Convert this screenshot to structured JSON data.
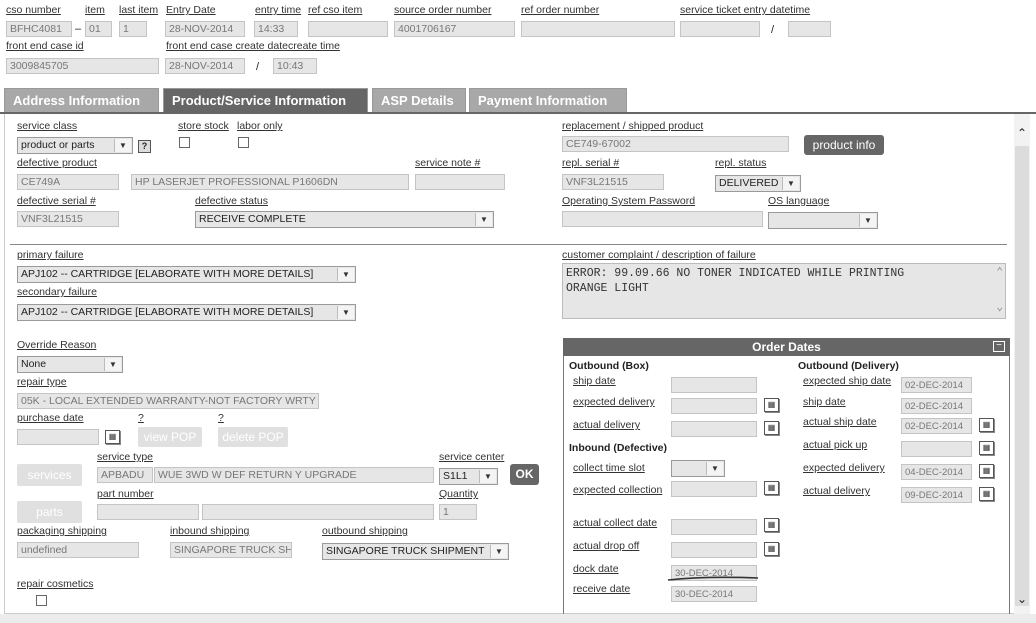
{
  "header": {
    "cso_number_label": "cso number",
    "cso_number": "BFHC4081",
    "dash": "–",
    "item_label": "item",
    "item": "01",
    "last_item_label": "last item",
    "last_item": "1",
    "entry_date_label": "Entry Date",
    "entry_date": "28-NOV-2014",
    "entry_time_label": "entry time",
    "entry_time": "14:33",
    "ref_cso_item_label": "ref cso item",
    "ref_cso_item": "",
    "source_order_label": "source order number",
    "source_order": "4001706167",
    "ref_order_label": "ref order number",
    "ref_order": "",
    "service_ticket_label": "service ticket entry datetime",
    "service_ticket_date": "",
    "slash": "/",
    "service_ticket_time": "",
    "front_end_case_label": "front end case id",
    "front_end_case": "3009845705",
    "front_end_create_label": "front end case create datecreate time",
    "front_end_create_date": "28-NOV-2014",
    "front_end_create_time": "10:43"
  },
  "tabs": [
    "Address Information",
    "Product/Service Information",
    "ASP Details",
    "Payment Information"
  ],
  "product": {
    "service_class_label": "service class",
    "service_class": "product or parts",
    "help_glyph": "?",
    "store_stock_label": "store stock",
    "labor_only_label": "labor only",
    "defective_product_label": "defective product",
    "defective_product": "CE749A",
    "defective_product_desc": "HP LASERJET PROFESSIONAL P1606DN",
    "service_note_label": "service note #",
    "service_note": "",
    "defective_serial_label": "defective serial #",
    "defective_serial": "VNF3L21515",
    "defective_status_label": "defective status",
    "defective_status": "RECEIVE COMPLETE",
    "replacement_label": "replacement / shipped product",
    "replacement": "CE749-67002",
    "product_info_button": "product info",
    "repl_serial_label": "repl. serial #",
    "repl_serial": "VNF3L21515",
    "repl_status_label": "repl. status",
    "repl_status": "DELIVERED",
    "os_password_label": "Operating System Password",
    "os_password": "",
    "os_language_label": "OS language",
    "os_language": ""
  },
  "failure": {
    "primary_label": "primary failure",
    "primary": "APJ102 -- CARTRIDGE [ELABORATE WITH MORE DETAILS]",
    "secondary_label": "secondary failure",
    "secondary": "APJ102 -- CARTRIDGE [ELABORATE WITH MORE DETAILS]",
    "complaint_label": "customer complaint / description of failure",
    "complaint_line1": "ERROR: 99.09.66 NO TONER INDICATED WHILE PRINTING",
    "complaint_line2": "ORANGE LIGHT"
  },
  "repair": {
    "override_label": "Override Reason",
    "override": "None",
    "repair_type_label": "repair type",
    "repair_type": "05K - LOCAL EXTENDED WARRANTY-NOT FACTORY WRTY",
    "purchase_date_label": "purchase date",
    "purchase_date": "",
    "q1": "?",
    "q2": "?",
    "view_pop": "view POP",
    "delete_pop": "delete POP",
    "services_button": "services",
    "service_type_label": "service type",
    "service_type_code": "APBADU",
    "service_type_desc": "WUE 3WD W DEF RETURN Y UPGRADE",
    "service_center_label": "service center",
    "service_center": "S1L1",
    "ok_button": "OK",
    "parts_button": "parts",
    "part_number_label": "part number",
    "part_number": "",
    "part_desc": "",
    "quantity_label": "Quantity",
    "quantity": "1",
    "packaging_label": "packaging shipping",
    "packaging": "undefined",
    "inbound_label": "inbound shipping",
    "inbound": "SINGAPORE TRUCK SHIP",
    "outbound_label": "outbound shipping",
    "outbound": "SINGAPORE TRUCK SHIPMENT",
    "cosmetics_label": "repair cosmetics"
  },
  "order_dates": {
    "title": "Order Dates",
    "collapse_glyph": "−",
    "outbound_box_heading": "Outbound (Box)",
    "ship_date_label": "ship date",
    "expected_delivery_label": "expected delivery",
    "actual_delivery_label": "actual delivery",
    "inbound_heading": "Inbound (Defective)",
    "collect_slot_label": "collect time slot",
    "expected_collection_label": "expected collection",
    "actual_collect_label": "actual collect date",
    "actual_drop_label": "actual drop off",
    "dock_date_label": "dock date",
    "dock_date": "30-DEC-2014",
    "receive_date_label": "receive date",
    "receive_date": "30-DEC-2014",
    "outbound_delivery_heading": "Outbound (Delivery)",
    "exp_ship_label": "expected ship date",
    "exp_ship": "02-DEC-2014",
    "ship_label": "ship date",
    "ship": "02-DEC-2014",
    "actual_ship_label": "actual ship date",
    "actual_ship": "02-DEC-2014",
    "actual_pickup_label": "actual pick up",
    "actual_pickup": "",
    "exp_deliv_label": "expected delivery",
    "exp_deliv": "04-DEC-2014",
    "act_deliv_label": "actual delivery",
    "act_deliv": "09-DEC-2014"
  },
  "icons": {
    "calendar": "calendar-icon",
    "dropdown": "chevron-down-icon",
    "scroll_up": "chevron-up-icon",
    "scroll_down": "chevron-down-icon"
  },
  "colors": {
    "tab_active": "#666666",
    "tab_inactive": "#a8a8a8",
    "panel_header": "#666666"
  }
}
